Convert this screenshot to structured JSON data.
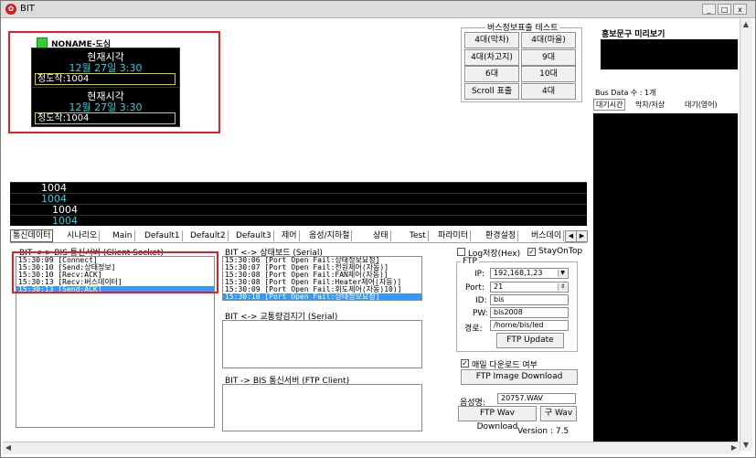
{
  "window": {
    "title": "BIT",
    "icon": "app-logo-icon",
    "controls": {
      "minimize": "_",
      "maximize": "□",
      "close": "x"
    }
  },
  "device": {
    "name": "NONAME-도심",
    "panels": [
      {
        "line1": "현재시각",
        "line2": "12월 27일 3:30",
        "line3": "정도착:1004"
      },
      {
        "line1": "현재시각",
        "line2": "12월 27일 3:30",
        "line3": "정도착:1004"
      }
    ]
  },
  "bus_test": {
    "title": "버스정보표출 테스트",
    "buttons": [
      "4대(막차)",
      "4대(마을)",
      "4대(차고지)",
      "9대",
      "6대",
      "10대",
      "Scroll 표출",
      "4대"
    ]
  },
  "promo": {
    "title": "홍보문구 미리보기",
    "bus_count": "Bus Data 수 : 1개",
    "tabs": [
      "대기시간",
      "막차/저상",
      "대기(영어)"
    ]
  },
  "led_rows": [
    "1004",
    "1004",
    "1004",
    "1004"
  ],
  "tabs": [
    "통신데이터",
    "시나리오",
    "Main",
    "Default1",
    "Default2",
    "Default3",
    "제어",
    "음성/지하철",
    "상태",
    "Test",
    "파라미터",
    "환경설정",
    "버스데이"
  ],
  "bis_server": {
    "label": "BIT <-> BIS 통신서버 (Client Socket)",
    "rows": [
      "15:30:09 [Connect]",
      "15:30:10 [Send:상태정보]",
      "15:30:10 [Recv:ACK]",
      "15:30:13 [Recv:버스데이터]",
      "15:30:13 [Send:ACK]"
    ],
    "selected": 4
  },
  "status_board": {
    "label": "BIT <-> 상태보드 (Serial)",
    "rows": [
      "15:30:06 [Port Open Fail:상태정보요청]",
      "15:30:07 [Port Open Fail:전원제어(자동)]",
      "15:30:08 [Port Open Fail:FAN제어(자동)]",
      "15:30:08 [Port Open Fail:Heater제어(자동)]",
      "15:30:09 [Port Open Fail:휘도제어(자동)10)]",
      "15:30:10 [Port Open Fail:상태정보요청]"
    ],
    "selected": 5
  },
  "traffic_sensor": {
    "label": "BIT <-> 교통량검지기 (Serial)"
  },
  "ftp_client": {
    "label": "BIT -> BIS 통신서버 (FTP Client)"
  },
  "options": {
    "log_save": "Log저장(Hex)",
    "log_save_checked": false,
    "stay_on_top": "StayOnTop",
    "stay_on_top_checked": true
  },
  "ftp": {
    "title": "FTP",
    "ip_label": "IP:",
    "ip": "192,168,1,23",
    "port_label": "Port:",
    "port": "21",
    "id_label": "ID:",
    "id": "bis",
    "pw_label": "PW:",
    "pw": "bis2008",
    "path_label": "경로:",
    "path": "/home/bis/led",
    "update_btn": "FTP Update"
  },
  "daily_download": {
    "label": "매일 다운로드 여부",
    "checked": true,
    "btn": "FTP Image Download"
  },
  "sound": {
    "label": "음성명:",
    "file": "20757.WAV",
    "download_btn": "FTP Wav Download",
    "old_wav_btn": "구 Wav"
  },
  "version": "Version : 7.5",
  "colors": {
    "highlight": "#e81e25",
    "led_cyan": "#27d3e6",
    "select": "#3399ff"
  }
}
